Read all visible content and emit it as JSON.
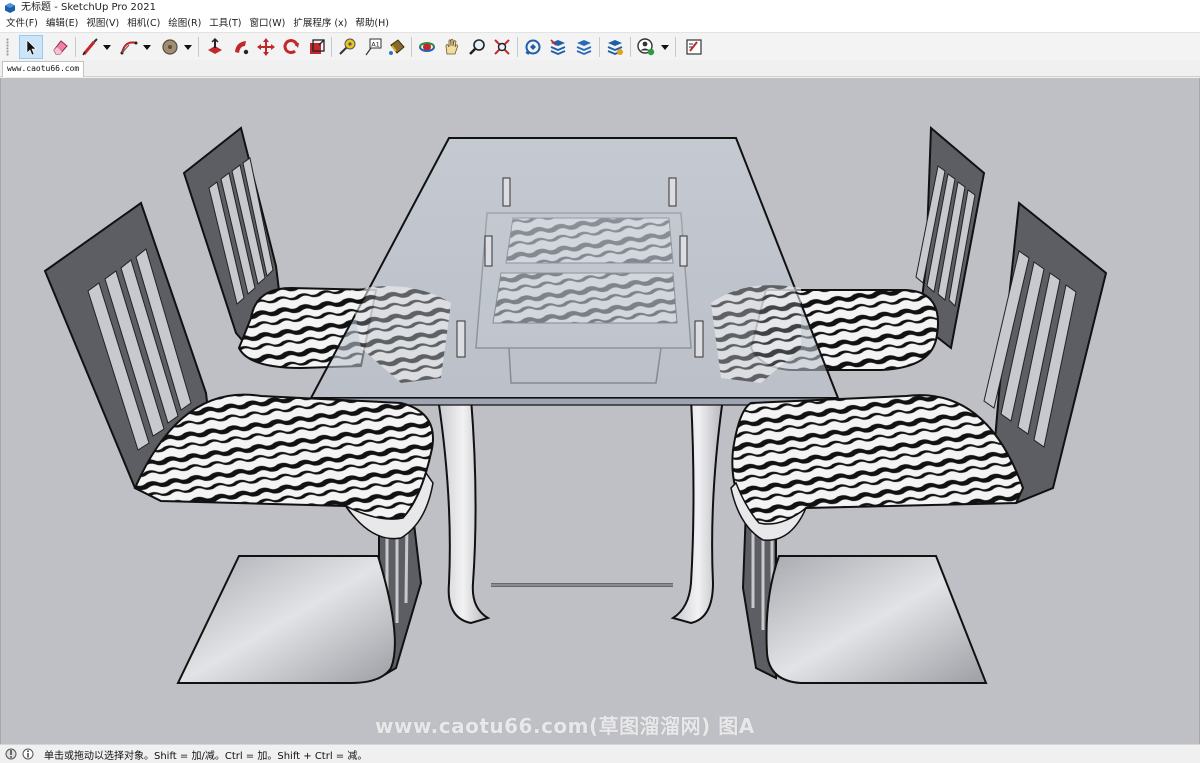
{
  "window": {
    "title": "无标题 - SketchUp Pro 2021"
  },
  "menu": [
    "文件(F)",
    "编辑(E)",
    "视图(V)",
    "相机(C)",
    "绘图(R)",
    "工具(T)",
    "窗口(W)",
    "扩展程序 (x)",
    "帮助(H)"
  ],
  "toolbar": {
    "tools": [
      {
        "name": "select-icon",
        "active": true
      },
      {
        "name": "eraser-icon"
      },
      {
        "name": "line-icon"
      },
      {
        "name": "arc-icon"
      },
      {
        "name": "shape-icon"
      },
      {
        "name": "push-pull-icon"
      },
      {
        "name": "follow-me-icon"
      },
      {
        "name": "move-icon"
      },
      {
        "name": "rotate-icon"
      },
      {
        "name": "scale-icon"
      },
      {
        "name": "tape-measure-icon"
      },
      {
        "name": "text-icon"
      },
      {
        "name": "paint-bucket-icon"
      },
      {
        "name": "orbit-icon"
      },
      {
        "name": "pan-icon"
      },
      {
        "name": "zoom-icon"
      },
      {
        "name": "zoom-extents-icon"
      },
      {
        "name": "3d-warehouse-icon"
      },
      {
        "name": "extension-warehouse-icon"
      },
      {
        "name": "layout-icon"
      },
      {
        "name": "extension-manager-icon"
      },
      {
        "name": "account-icon"
      },
      {
        "name": "send-to-layout-icon"
      }
    ]
  },
  "scene_tab": {
    "label": "www.caotu66.com"
  },
  "viewport": {
    "background": "#bfc0c6",
    "watermark": "www.caotu66.com(草图溜溜网) 图A"
  },
  "status": {
    "text": "单击或拖动以选择对象。Shift = 加/减。Ctrl = 加。Shift + Ctrl = 减。"
  },
  "colors": {
    "accent": "#0078d7",
    "active_tool_bg": "#cce4f7",
    "metal": "#5d5e63"
  }
}
